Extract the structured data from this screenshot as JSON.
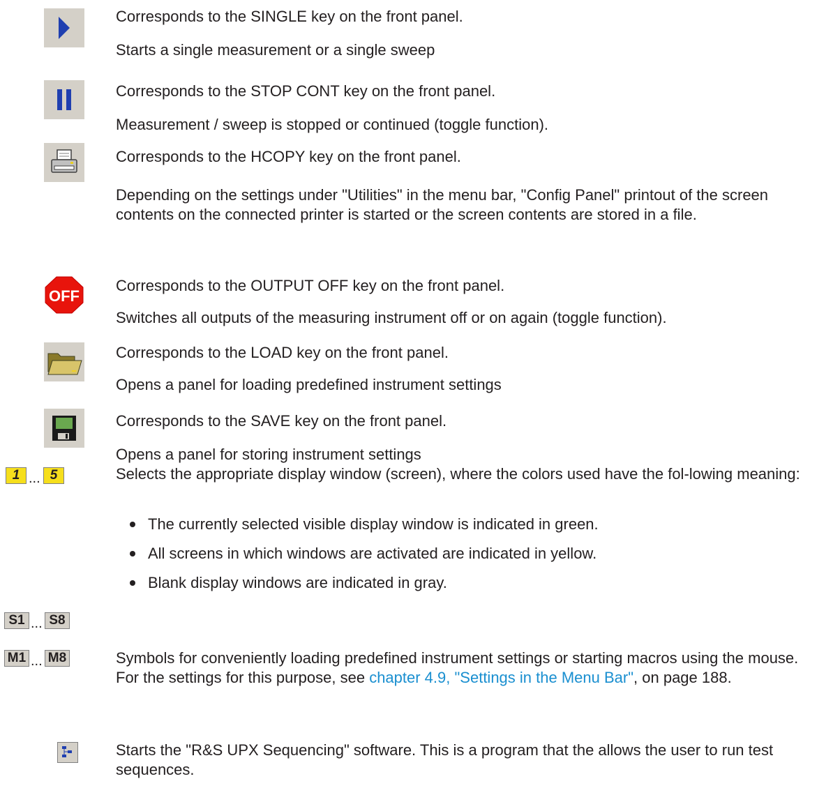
{
  "items": [
    {
      "l1": "Corresponds to the SINGLE key on the front panel.",
      "l2": "Starts a single measurement or a single sweep"
    },
    {
      "l1": "Corresponds to the STOP CONT key on the front panel.",
      "l2": "Measurement / sweep is stopped or continued (toggle function)."
    },
    {
      "l1": "Corresponds to the HCOPY key on the front panel.",
      "l2": "Depending on the settings under \"Utilities\" in the menu bar, \"Config Panel\" printout of the screen contents on the connected printer is started or the screen contents are stored in a file."
    },
    {
      "l1": "Corresponds to the OUTPUT OFF key on the front panel.",
      "l2": "Switches all outputs of the measuring instrument off or on again (toggle function)."
    },
    {
      "l1": "Corresponds to the LOAD key on the front panel.",
      "l2": "Opens a panel for loading predefined instrument settings"
    },
    {
      "l1": "Corresponds to the SAVE key on the front panel.",
      "l2": "Opens a panel for storing instrument settings"
    }
  ],
  "icons": {
    "off_label": "OFF",
    "screen_first": "1",
    "screen_last": "5",
    "s_first": "S1",
    "s_last": "S8",
    "m_first": "M1",
    "m_last": "M8",
    "ellipsis": "..."
  },
  "screens": {
    "text": "Selects the appropriate display window (screen), where the colors used have the fol-lowing meaning:",
    "bullets": [
      "The currently selected visible display window is indicated in green.",
      "All screens in which windows are activated are indicated in yellow.",
      "Blank display windows are indicated in gray."
    ]
  },
  "macros": {
    "text_before": "Symbols for conveniently loading predefined instrument settings or starting macros using the mouse. For the settings for this purpose, see ",
    "link_text": "chapter 4.9, \"Settings in the Menu Bar\"",
    "text_after": ", on page 188."
  },
  "sequencing": {
    "text": "Starts the \"R&S UPX Sequencing\" software. This is a program that the allows the user to run test sequences."
  },
  "colors": {
    "icon_blue": "#1f3fb0",
    "off_red": "#e8140c",
    "screen_yellow": "#f6df1c",
    "link": "#1a8fd0"
  }
}
